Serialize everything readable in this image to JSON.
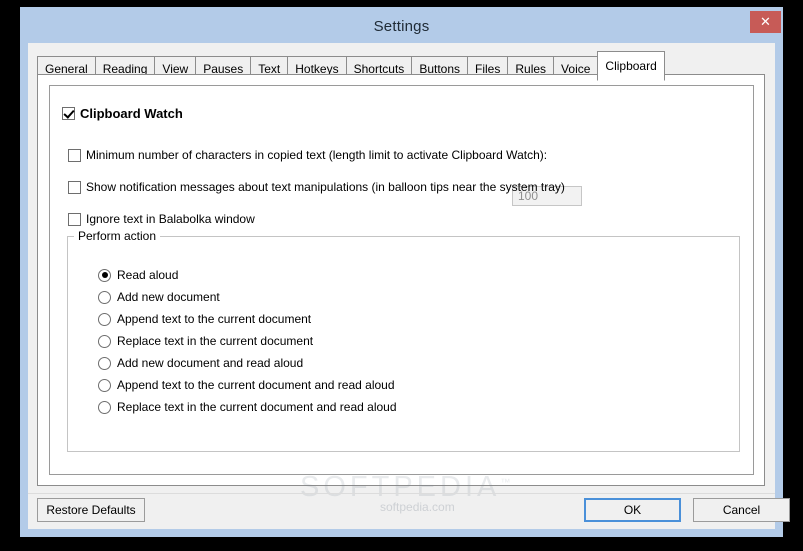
{
  "window": {
    "title": "Settings",
    "close_label": "✕"
  },
  "tabs": [
    {
      "label": "General",
      "active": false
    },
    {
      "label": "Reading",
      "active": false
    },
    {
      "label": "View",
      "active": false
    },
    {
      "label": "Pauses",
      "active": false
    },
    {
      "label": "Text",
      "active": false
    },
    {
      "label": "Hotkeys",
      "active": false
    },
    {
      "label": "Shortcuts",
      "active": false
    },
    {
      "label": "Buttons",
      "active": false
    },
    {
      "label": "Files",
      "active": false
    },
    {
      "label": "Rules",
      "active": false
    },
    {
      "label": "Voice",
      "active": false
    },
    {
      "label": "Clipboard",
      "active": true
    }
  ],
  "clipboard_page": {
    "clipboard_watch": {
      "label": "Clipboard Watch",
      "checked": true
    },
    "min_chars": {
      "label": "Minimum number of characters in copied text (length limit to activate Clipboard Watch):",
      "checked": false,
      "value": "100",
      "enabled": false
    },
    "show_notifications": {
      "label": "Show notification messages about text manipulations (in balloon tips near the system tray)",
      "checked": false
    },
    "ignore_balabolka": {
      "label": "Ignore text in Balabolka window",
      "checked": false
    },
    "perform_action": {
      "legend": "Perform action",
      "options": [
        {
          "label": "Read aloud",
          "selected": true
        },
        {
          "label": "Add new document",
          "selected": false
        },
        {
          "label": "Append text to the current document",
          "selected": false
        },
        {
          "label": "Replace text in the current document",
          "selected": false
        },
        {
          "label": "Add new document and read aloud",
          "selected": false
        },
        {
          "label": "Append text to the current document and read aloud",
          "selected": false
        },
        {
          "label": "Replace text in the current document and read aloud",
          "selected": false
        }
      ]
    }
  },
  "watermark": {
    "text": "SOFTPEDIA",
    "sub": "softpedia.com"
  },
  "footer": {
    "restore_defaults": "Restore Defaults",
    "ok": "OK",
    "cancel": "Cancel"
  },
  "colors": {
    "titlebar": "#b3cbe8",
    "close_button": "#c75b57",
    "focus_border": "#4a90d9",
    "client_bg": "#f0f0f0",
    "panel_bg": "#ffffff"
  }
}
